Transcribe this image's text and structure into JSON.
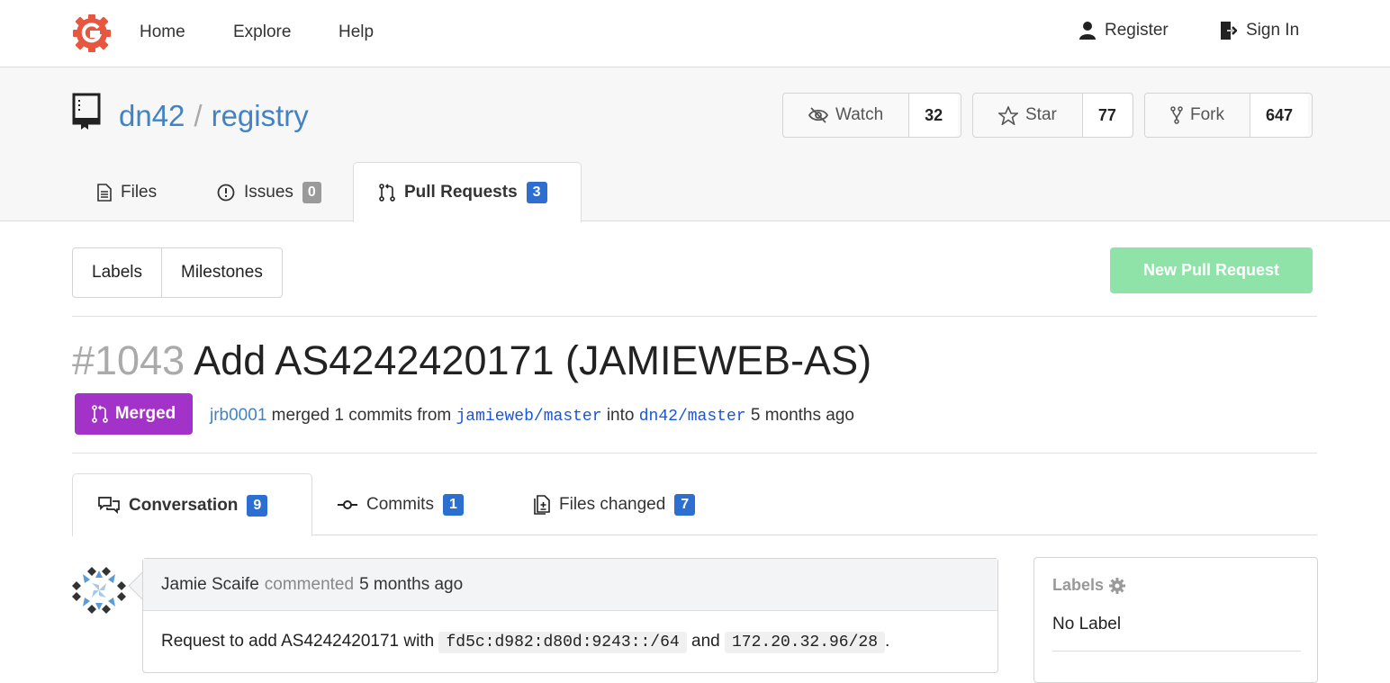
{
  "nav": {
    "home": "Home",
    "explore": "Explore",
    "help": "Help",
    "register": "Register",
    "sign_in": "Sign In"
  },
  "repo": {
    "owner": "dn42",
    "separator": "/",
    "name": "registry",
    "watch_label": "Watch",
    "watch_count": "32",
    "star_label": "Star",
    "star_count": "77",
    "fork_label": "Fork",
    "fork_count": "647"
  },
  "tabs": {
    "files": "Files",
    "issues": "Issues",
    "issues_count": "0",
    "pull_requests": "Pull Requests",
    "pull_requests_count": "3"
  },
  "submenu": {
    "labels": "Labels",
    "milestones": "Milestones",
    "new_pr": "New Pull Request"
  },
  "pr": {
    "number": "#1043",
    "title": "Add AS4242420171 (JAMIEWEB-AS)",
    "status": "Merged",
    "merger": "jrb0001",
    "merged_text": "merged 1 commits from",
    "from_branch": "jamieweb/master",
    "into_text": "into",
    "into_branch": "dn42/master",
    "time": "5 months ago"
  },
  "conv_tabs": {
    "conversation": "Conversation",
    "conversation_count": "9",
    "commits": "Commits",
    "commits_count": "1",
    "files_changed": "Files changed",
    "files_changed_count": "7"
  },
  "comment": {
    "author": "Jamie Scaife",
    "action": "commented",
    "time": "5 months ago",
    "body_prefix": "Request to add AS4242420171 with",
    "ipv6": "fd5c:d982:d80d:9243::/64",
    "and": "and",
    "ipv4": "172.20.32.96/28",
    "suffix": "."
  },
  "sidebar": {
    "labels_heading": "Labels",
    "labels_value": "No Label"
  },
  "colors": {
    "link": "#4183c4",
    "merged": "#a333c8",
    "new_pr": "#8fe3a9",
    "badge": "#2d6fd1",
    "logo": "#e8563f"
  }
}
